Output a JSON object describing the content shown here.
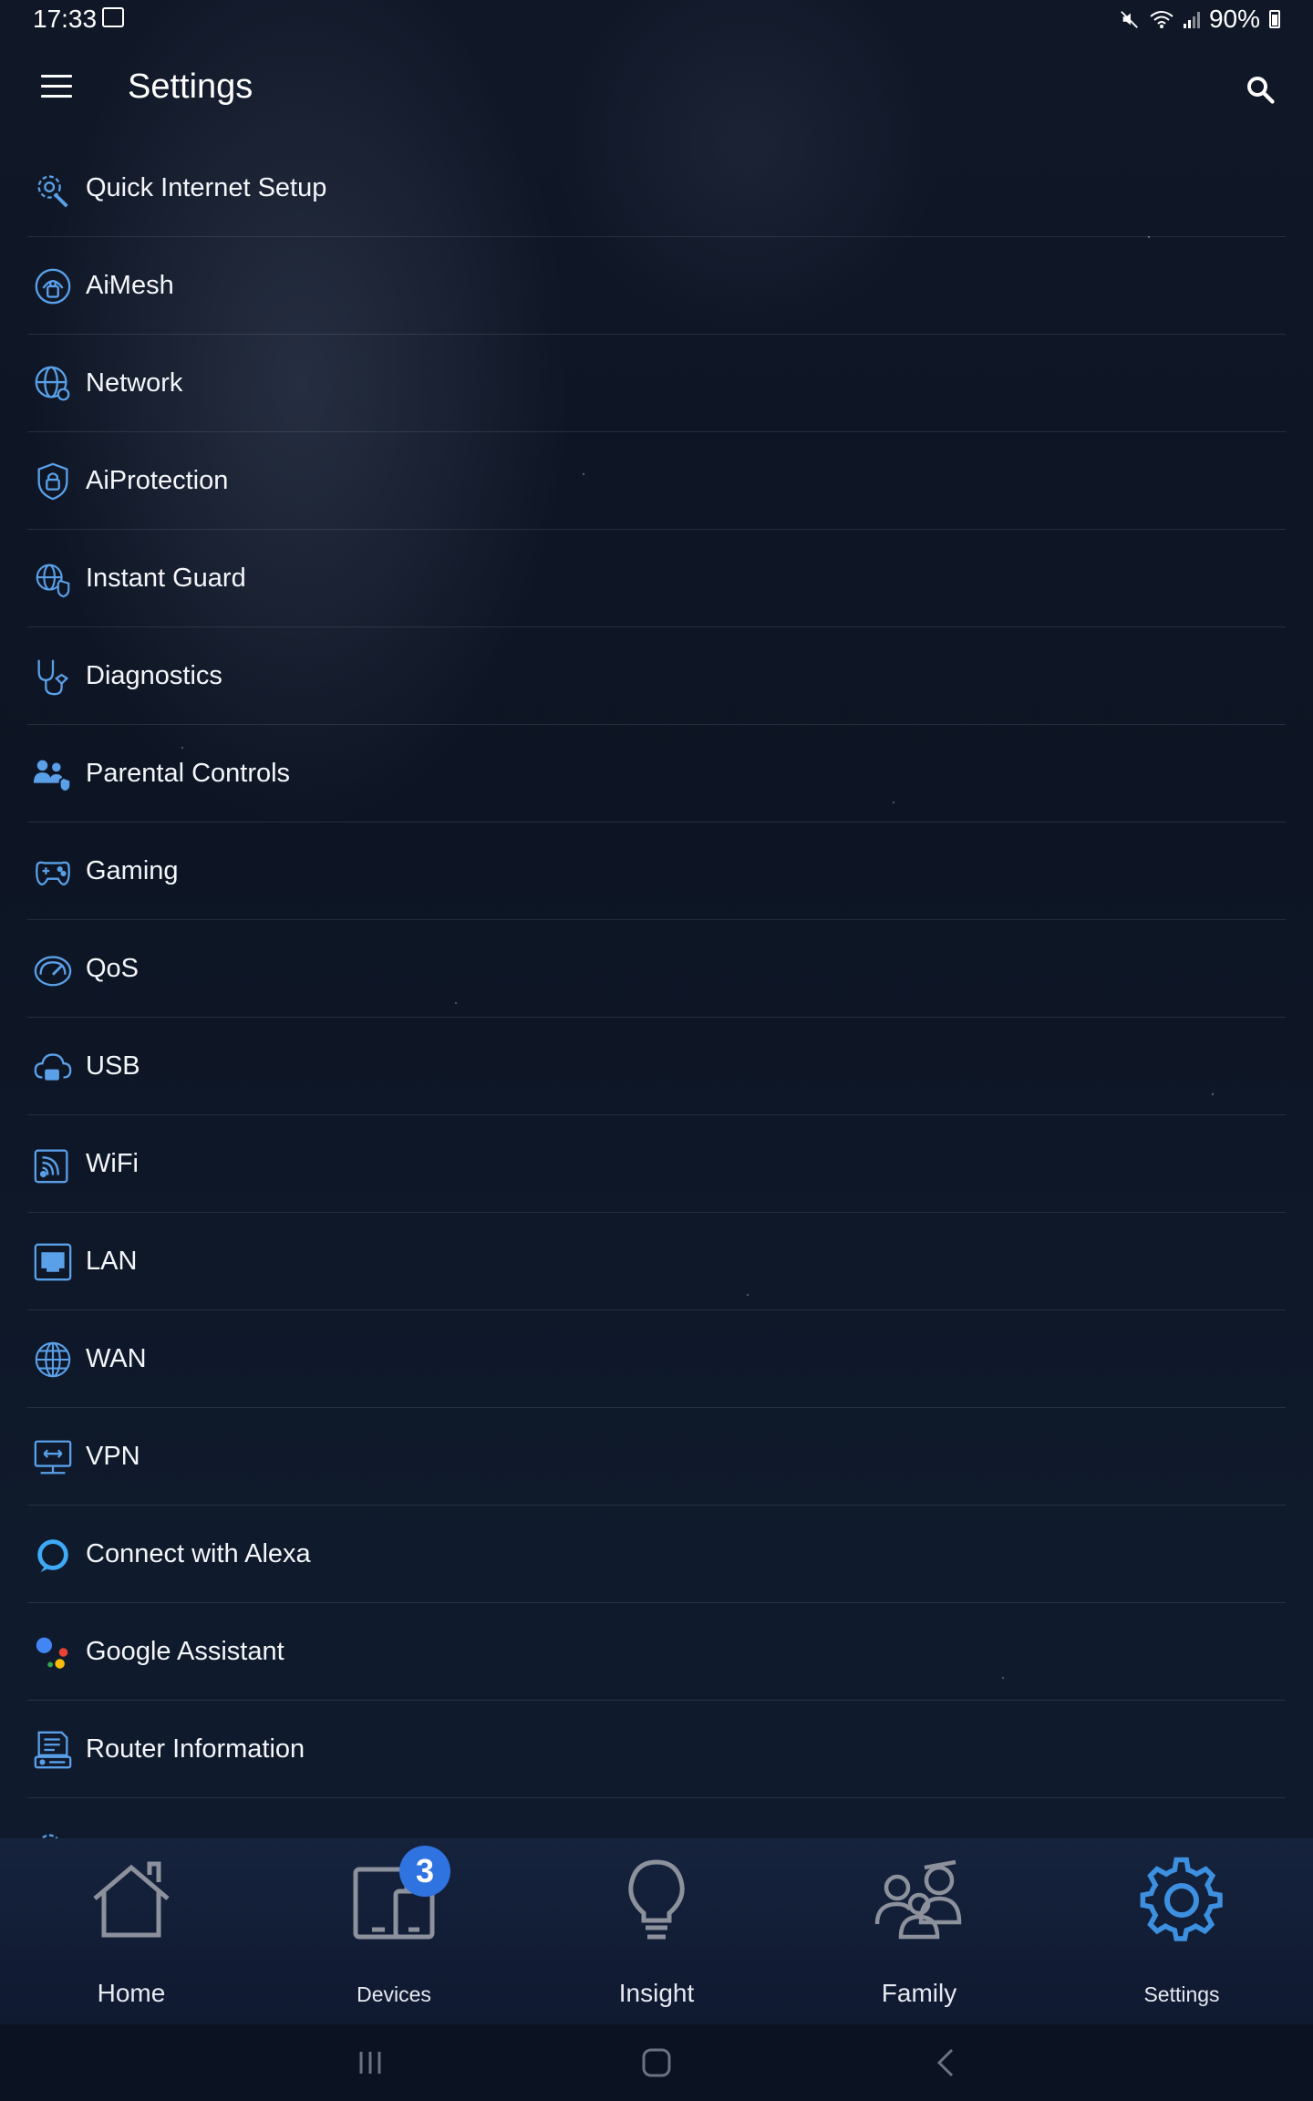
{
  "status_bar": {
    "time": "17:33",
    "battery": "90%"
  },
  "header": {
    "title": "Settings"
  },
  "settings_items": [
    {
      "label": "Quick Internet Setup",
      "icon": "quick-setup-icon"
    },
    {
      "label": "AiMesh",
      "icon": "aimesh-icon"
    },
    {
      "label": "Network",
      "icon": "network-globe-icon"
    },
    {
      "label": "AiProtection",
      "icon": "shield-lock-icon"
    },
    {
      "label": "Instant Guard",
      "icon": "instant-guard-icon"
    },
    {
      "label": "Diagnostics",
      "icon": "stethoscope-icon"
    },
    {
      "label": "Parental Controls",
      "icon": "parental-controls-icon"
    },
    {
      "label": "Gaming",
      "icon": "gamepad-icon"
    },
    {
      "label": "QoS",
      "icon": "speedometer-icon"
    },
    {
      "label": "USB",
      "icon": "usb-cloud-icon"
    },
    {
      "label": "WiFi",
      "icon": "wifi-icon"
    },
    {
      "label": "LAN",
      "icon": "lan-port-icon"
    },
    {
      "label": "WAN",
      "icon": "wan-globe-icon"
    },
    {
      "label": "VPN",
      "icon": "vpn-monitor-icon"
    },
    {
      "label": "Connect with Alexa",
      "icon": "alexa-icon"
    },
    {
      "label": "Google Assistant",
      "icon": "google-assistant-icon"
    },
    {
      "label": "Router Information",
      "icon": "router-info-icon"
    }
  ],
  "bottom_nav": {
    "tabs": [
      {
        "label": "Home",
        "icon": "home-icon"
      },
      {
        "label": "Devices",
        "icon": "devices-icon",
        "badge": "3"
      },
      {
        "label": "Insight",
        "icon": "lightbulb-icon"
      },
      {
        "label": "Family",
        "icon": "family-icon"
      },
      {
        "label": "Settings",
        "icon": "gear-icon",
        "active": true
      }
    ]
  },
  "colors": {
    "accent": "#3d8fe0",
    "badge": "#2f73e0",
    "inactive_icon": "#8c919c"
  }
}
